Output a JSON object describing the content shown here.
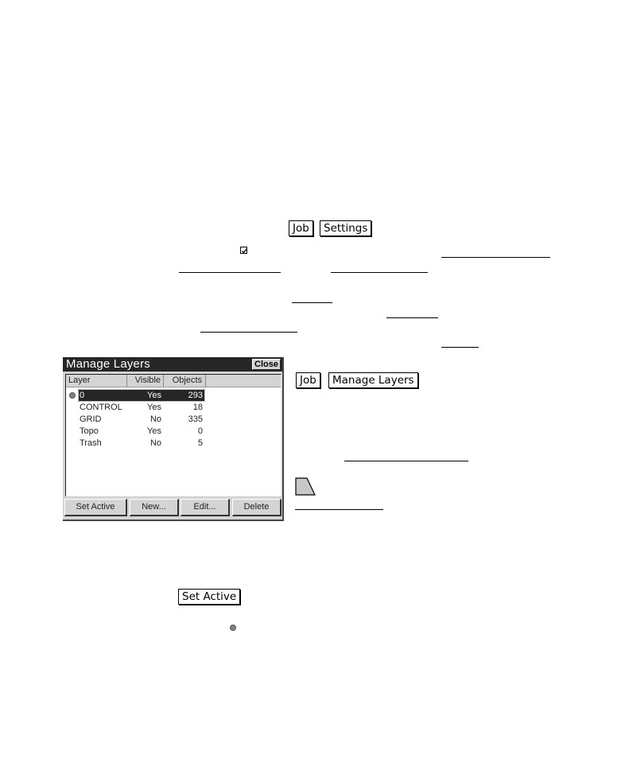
{
  "text_refs": {
    "job_key": "Job",
    "settings_key": "Settings",
    "job_key_2": "Job",
    "manage_layers_key": "Manage Layers",
    "set_active_key": "Set Active"
  },
  "icons": {
    "checkbox": "checkbox-checked-icon",
    "active_layer_marker": "active-layer-dot-icon",
    "shape": "trapezoid-icon"
  },
  "dialog": {
    "title": "Manage Layers",
    "close_label": "Close",
    "columns": [
      "Layer",
      "Visible",
      "Objects"
    ],
    "rows": [
      {
        "layer": "0",
        "visible": "Yes",
        "objects": "293",
        "active": true,
        "selected": true
      },
      {
        "layer": "CONTROL",
        "visible": "Yes",
        "objects": "18",
        "active": false,
        "selected": false
      },
      {
        "layer": "GRID",
        "visible": "No",
        "objects": "335",
        "active": false,
        "selected": false
      },
      {
        "layer": "Topo",
        "visible": "Yes",
        "objects": "0",
        "active": false,
        "selected": false
      },
      {
        "layer": "Trash",
        "visible": "No",
        "objects": "5",
        "active": false,
        "selected": false
      }
    ],
    "buttons": {
      "set_active": "Set Active",
      "new": "New...",
      "edit": "Edit...",
      "delete": "Delete"
    }
  },
  "colors": {
    "titlebar": "#262626",
    "dialog_bg": "#d4d4d4",
    "selection": "#262626",
    "active_dot": "#808080"
  }
}
